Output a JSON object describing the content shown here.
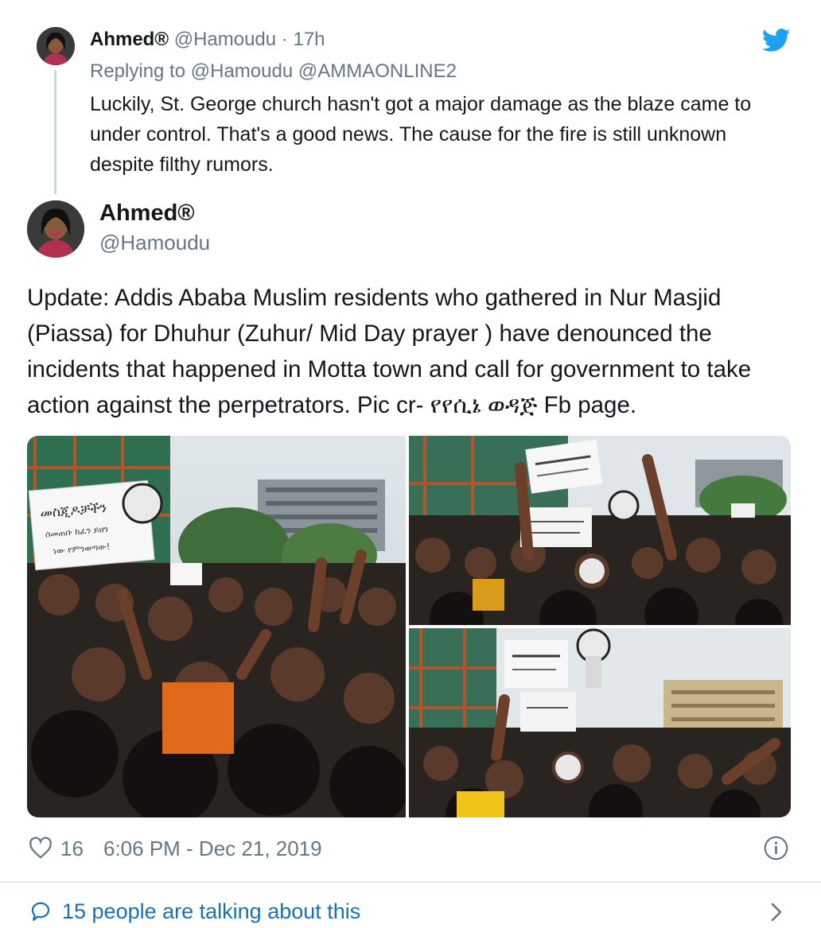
{
  "parent_tweet": {
    "name": "Ahmed®",
    "handle": "@Hamoudu",
    "separator": " · ",
    "time": "17h",
    "replying_prefix": "Replying to ",
    "replying_to": [
      "@Hamoudu",
      "@AMMAONLINE2"
    ],
    "text": "Luckily, St. George church hasn't got a major damage as the blaze came to under control. That's a good news. The cause for the fire is still unknown despite filthy rumors."
  },
  "main_tweet": {
    "name": "Ahmed®",
    "handle": "@Hamoudu",
    "text": "Update:  Addis Ababa Muslim residents who gathered in Nur Masjid (Piassa) for Dhuhur (Zuhur/ Mid Day prayer ) have denounced the incidents that happened in Motta town and call for government to take action against the perpetrators. Pic cr- የየሲኔ ወዳጅ Fb page.",
    "like_count": "16",
    "timestamp": "6:06 PM - Dec 21, 2019",
    "talking": "15 people are talking about this"
  },
  "photo_signs": {
    "sign_1": "መስጂዶቻችን",
    "sign_2": "ሰመጠቡ ከፈን ይዘን",
    "sign_3": "ነው የምንወጣው!"
  },
  "icons": {
    "logo": "twitter-bird-icon",
    "like": "heart-icon",
    "info": "info-icon",
    "talk": "speech-bubble-icon",
    "more": "chevron-right-icon"
  },
  "colors": {
    "twitter_blue": "#1da1f2",
    "link_blue": "#1b6fb5",
    "meta_gray": "#657786",
    "text": "#14171a"
  }
}
